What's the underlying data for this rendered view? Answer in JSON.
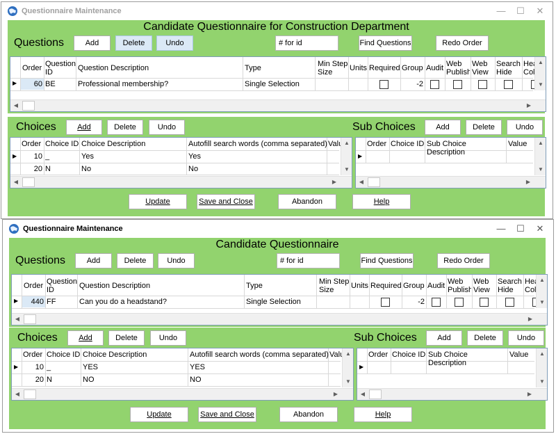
{
  "windows": [
    {
      "title": "Questionnaire Maintenance",
      "heading": "Candidate Questionnaire for Construction Department",
      "questions": {
        "label": "Questions",
        "buttons": {
          "add": "Add",
          "delete": "Delete",
          "undo": "Undo"
        },
        "search_value": "# for id",
        "find_button": "Find Questions",
        "redo_button": "Redo Order",
        "columns": [
          "Order",
          "Question ID",
          "Question Description",
          "Type",
          "Min Step Size",
          "Units",
          "Required",
          "Group",
          "Audit",
          "Web Publish",
          "Web View",
          "Search Hide",
          "Hea Colla"
        ],
        "rows": [
          {
            "order": "60",
            "question_id": "BE",
            "description": "Professional membership?",
            "type": "Single Selection",
            "group": "-2"
          }
        ]
      },
      "choices": {
        "label": "Choices",
        "buttons": {
          "add": "Add",
          "delete": "Delete",
          "undo": "Undo"
        },
        "columns": [
          "Order",
          "Choice ID",
          "Choice Description",
          "Autofill search words (comma separated)",
          "Valu"
        ],
        "rows": [
          {
            "order": "10",
            "choice_id": "_",
            "description": "Yes",
            "autofill": "Yes"
          },
          {
            "order": "20",
            "choice_id": "N",
            "description": "No",
            "autofill": "No"
          }
        ]
      },
      "sub_choices": {
        "label": "Sub Choices",
        "buttons": {
          "add": "Add",
          "delete": "Delete",
          "undo": "Undo"
        },
        "columns": [
          "Order",
          "Choice ID",
          "Sub Choice Description",
          "Value"
        ]
      },
      "footer": {
        "update": "Update",
        "save_close": "Save and Close",
        "abandon": "Abandon",
        "help": "Help"
      }
    },
    {
      "title": "Questionnaire Maintenance",
      "heading": "Candidate Questionnaire",
      "questions": {
        "label": "Questions",
        "buttons": {
          "add": "Add",
          "delete": "Delete",
          "undo": "Undo"
        },
        "search_value": "# for id",
        "find_button": "Find Questions",
        "redo_button": "Redo Order",
        "columns": [
          "Order",
          "Question ID",
          "Question Description",
          "Type",
          "Min Step Size",
          "Units",
          "Required",
          "Group",
          "Audit",
          "Web Publish",
          "Web View",
          "Search Hide",
          "Hea Colla"
        ],
        "rows": [
          {
            "order": "440",
            "question_id": "FF",
            "description": "Can you do a headstand?",
            "type": "Single Selection",
            "group": "-2"
          }
        ]
      },
      "choices": {
        "label": "Choices",
        "buttons": {
          "add": "Add",
          "delete": "Delete",
          "undo": "Undo"
        },
        "columns": [
          "Order",
          "Choice ID",
          "Choice Description",
          "Autofill search words (comma separated)",
          "Valu"
        ],
        "rows": [
          {
            "order": "10",
            "choice_id": "_",
            "description": "YES",
            "autofill": "YES"
          },
          {
            "order": "20",
            "choice_id": "N",
            "description": "NO",
            "autofill": "NO"
          }
        ]
      },
      "sub_choices": {
        "label": "Sub Choices",
        "buttons": {
          "add": "Add",
          "delete": "Delete",
          "undo": "Undo"
        },
        "columns": [
          "Order",
          "Choice ID",
          "Sub Choice Description",
          "Value"
        ]
      },
      "footer": {
        "update": "Update",
        "save_close": "Save and Close",
        "abandon": "Abandon",
        "help": "Help"
      }
    }
  ],
  "window_controls": {
    "minimize": "—",
    "maximize": "☐",
    "close": "✕"
  },
  "colors": {
    "panel_green": "#92d36e",
    "selection_blue": "#dbe9f6"
  }
}
